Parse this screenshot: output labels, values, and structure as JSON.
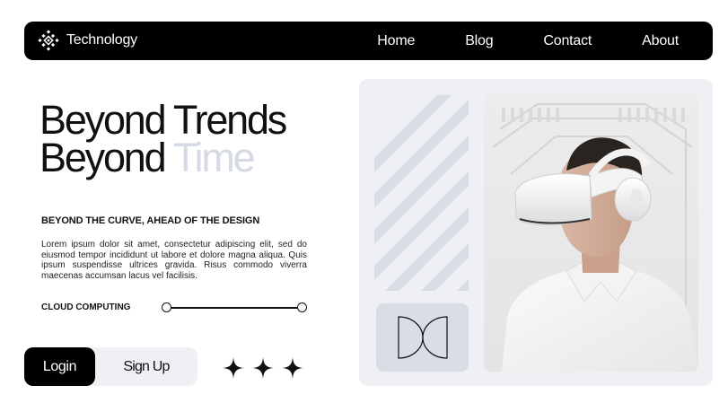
{
  "nav": {
    "brand": "Technology",
    "links": [
      "Home",
      "Blog",
      "Contact",
      "About"
    ]
  },
  "hero": {
    "line1": "Beyond Trends",
    "line2_dark": "Beyond",
    "line2_muted": "Time",
    "subheading": "BEYOND THE CURVE, AHEAD OF THE DESIGN",
    "body": "Lorem ipsum dolor sit amet, consectetur adipiscing elit, sed do eiusmod tempor incididunt ut labore et dolore magna aliqua. Quis ipsum suspendisse ultrices gravida. Risus commodo viverra maecenas accumsan lacus vel facilisis."
  },
  "feature": {
    "label": "CLOUD COMPUTING"
  },
  "buttons": {
    "login": "Login",
    "signup": "Sign Up"
  },
  "colors": {
    "nav_bg": "#000000",
    "muted_text": "#d5dae4",
    "panel_bg": "#eef0f4",
    "stripe": "#d8dde6",
    "logo_tile": "#d8dde6"
  },
  "icons": [
    "brand-logo-icon",
    "sparkle-star-icon",
    "dc-monogram-logo",
    "vr-headset-photo"
  ]
}
